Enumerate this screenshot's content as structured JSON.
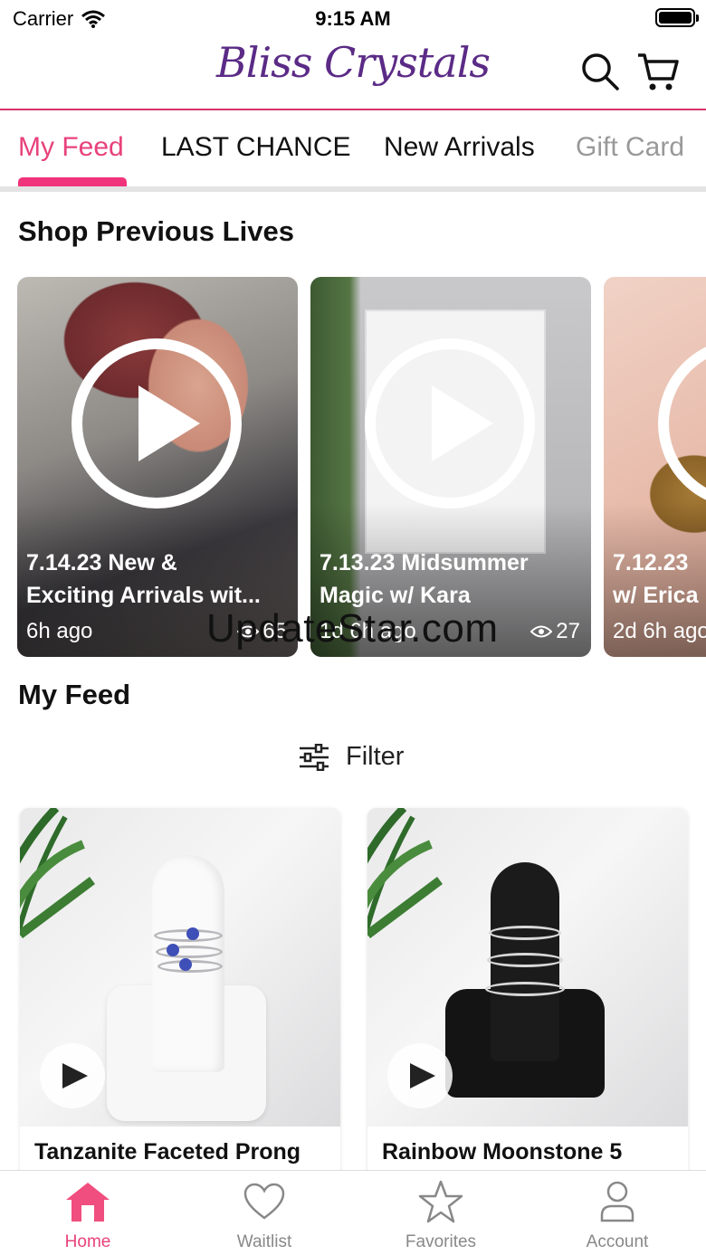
{
  "status_bar": {
    "carrier": "Carrier",
    "time": "9:15 AM"
  },
  "header": {
    "logo_text": "Bliss Crystals",
    "search_icon": "search-icon",
    "cart_icon": "cart-icon"
  },
  "tabs": [
    {
      "label": "My Feed",
      "active": true
    },
    {
      "label": "LAST CHANCE",
      "active": false
    },
    {
      "label": "New Arrivals",
      "active": false
    },
    {
      "label": "Gift Card",
      "active": false
    }
  ],
  "lives_section": {
    "title": "Shop Previous Lives",
    "items": [
      {
        "title_line1": "7.14.23 New &",
        "title_line2": "Exciting Arrivals wit...",
        "ago": "6h ago",
        "views": "65"
      },
      {
        "title_line1": "7.13.23 Midsummer",
        "title_line2": "Magic w/ Kara",
        "ago": "1d 6h ago",
        "views": "27"
      },
      {
        "title_line1": "7.12.23",
        "title_line2": "w/ Erica",
        "ago": "2d 6h ago",
        "views": ""
      }
    ]
  },
  "watermark": "UpdateStar.com",
  "feed_section": {
    "title": "My Feed",
    "filter_label": "Filter"
  },
  "products": [
    {
      "name": "Tanzanite Faceted Prong"
    },
    {
      "name": "Rainbow Moonstone 5"
    }
  ],
  "bottom_nav": [
    {
      "label": "Home",
      "icon": "home-icon",
      "active": true
    },
    {
      "label": "Waitlist",
      "icon": "heart-icon",
      "active": false
    },
    {
      "label": "Favorites",
      "icon": "star-icon",
      "active": false
    },
    {
      "label": "Account",
      "icon": "user-icon",
      "active": false
    }
  ],
  "colors": {
    "accent": "#e8427c",
    "logo": "#5b2b86",
    "divider": "#d6336c"
  }
}
